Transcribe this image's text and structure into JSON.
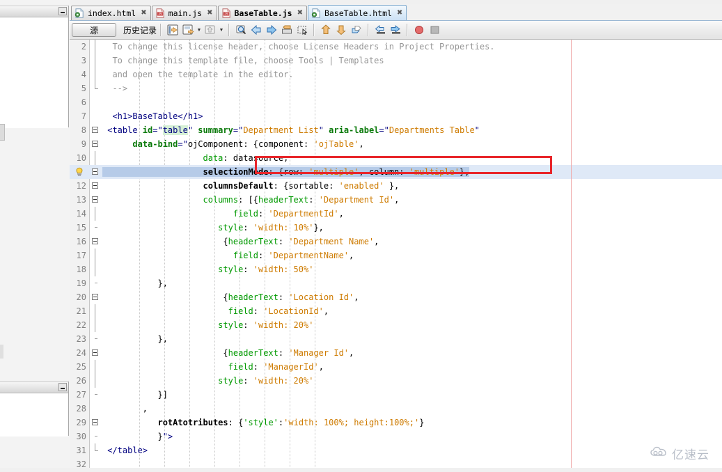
{
  "window": {
    "app": "NetBeans IDE",
    "left_panel_top": {
      "minimize_label": "minimize"
    },
    "left_panel_bottom": {
      "minimize_label": "minimize"
    }
  },
  "tabs": [
    {
      "label": "index.html",
      "icon": "html-file-icon",
      "close": "×",
      "active": false,
      "bold": false
    },
    {
      "label": "main.js",
      "icon": "js-file-icon",
      "close": "×",
      "active": false,
      "bold": false
    },
    {
      "label": "BaseTable.js",
      "icon": "js-file-icon",
      "close": "×",
      "active": false,
      "bold": true
    },
    {
      "label": "BaseTable.html",
      "icon": "html-file-icon",
      "close": "×",
      "active": true,
      "bold": false
    }
  ],
  "toolbar": {
    "source_label": "源",
    "history_label": "历史记录",
    "buttons": [
      {
        "name": "last-edit-icon"
      },
      {
        "name": "refactor-icon",
        "dropdown": true
      },
      {
        "name": "generate-code-icon",
        "dropdown": true
      },
      {
        "name": "find-selection-icon"
      },
      {
        "name": "back-icon"
      },
      {
        "name": "forward-icon"
      },
      {
        "name": "toggle-bookmark-icon"
      },
      {
        "name": "rectangular-selection-icon"
      },
      {
        "name": "previous-bookmark-icon"
      },
      {
        "name": "next-bookmark-icon"
      },
      {
        "name": "toggle-highlight-icon"
      },
      {
        "name": "shift-left-icon"
      },
      {
        "name": "shift-right-icon"
      },
      {
        "name": "start-macro-recording-icon"
      },
      {
        "name": "stop-macro-recording-icon"
      }
    ]
  },
  "editor": {
    "margin_guide_column_x": 720,
    "highlighted_line_number": 11,
    "annotation_color": "#e8262b",
    "lines": [
      {
        "n": "2",
        "indent": 0,
        "fold": "line",
        "tokens": [
          {
            "t": "comment",
            "v": "  To change this license header, choose License Headers in Project Properties."
          }
        ]
      },
      {
        "n": "3",
        "indent": 0,
        "fold": "line",
        "tokens": [
          {
            "t": "comment",
            "v": "  To change this template file, choose Tools | Templates"
          }
        ]
      },
      {
        "n": "4",
        "indent": 0,
        "fold": "line",
        "tokens": [
          {
            "t": "comment",
            "v": "  and open the template in the editor."
          }
        ]
      },
      {
        "n": "5",
        "indent": 0,
        "fold": "end",
        "tokens": [
          {
            "t": "comment",
            "v": "  -->"
          }
        ]
      },
      {
        "n": "6",
        "indent": 0,
        "fold": "none",
        "tokens": []
      },
      {
        "n": "7",
        "indent": 0,
        "fold": "none",
        "tokens": [
          {
            "t": "tag",
            "v": "  <h1>BaseTable</h1>"
          }
        ]
      },
      {
        "n": "8",
        "indent": 0,
        "fold": "box",
        "tokens": [
          {
            "t": "tag",
            "v": " <table "
          },
          {
            "t": "attr",
            "v": "id"
          },
          {
            "t": "tag",
            "v": "=\""
          },
          {
            "t": "idhl",
            "v": "table"
          },
          {
            "t": "tag",
            "v": "\" "
          },
          {
            "t": "attr",
            "v": "summary"
          },
          {
            "t": "tag",
            "v": "=\""
          },
          {
            "t": "str",
            "v": "Department List"
          },
          {
            "t": "tag",
            "v": "\" "
          },
          {
            "t": "attr",
            "v": "aria-label"
          },
          {
            "t": "tag",
            "v": "=\""
          },
          {
            "t": "str",
            "v": "Departments Table"
          },
          {
            "t": "tag",
            "v": "\""
          }
        ]
      },
      {
        "n": "9",
        "indent": 0,
        "fold": "box",
        "tokens": [
          {
            "t": "plain",
            "v": "      "
          },
          {
            "t": "attr",
            "v": "data-bind"
          },
          {
            "t": "tag",
            "v": "=\""
          },
          {
            "t": "plain",
            "v": "ojComponent"
          },
          {
            "t": "plain",
            "v": ": {component: "
          },
          {
            "t": "str",
            "v": "'ojTable'"
          },
          {
            "t": "plain",
            "v": ","
          }
        ]
      },
      {
        "n": "10",
        "indent": 0,
        "fold": "line",
        "tokens": [
          {
            "t": "plain",
            "v": "                    "
          },
          {
            "t": "green",
            "v": "data"
          },
          {
            "t": "plain",
            "v": ": datasource,"
          }
        ]
      },
      {
        "n": "11",
        "indent": 0,
        "fold": "box",
        "bulb": true,
        "highlight": true,
        "tokens": [
          {
            "t": "plain",
            "v": "                    "
          },
          {
            "t": "key",
            "v": "selectionMode"
          },
          {
            "t": "plain",
            "v": ": {row: "
          },
          {
            "t": "str",
            "v": "'multiple'"
          },
          {
            "t": "plain",
            "v": ", column: "
          },
          {
            "t": "str",
            "v": "'multiple'"
          },
          {
            "t": "plain",
            "v": "},"
          }
        ]
      },
      {
        "n": "12",
        "indent": 0,
        "fold": "box",
        "tokens": [
          {
            "t": "plain",
            "v": "                    "
          },
          {
            "t": "key",
            "v": "columnsDefault"
          },
          {
            "t": "plain",
            "v": ": {sortable: "
          },
          {
            "t": "str",
            "v": "'enabled'"
          },
          {
            "t": "plain",
            "v": " },"
          }
        ]
      },
      {
        "n": "13",
        "indent": 0,
        "fold": "box",
        "tokens": [
          {
            "t": "plain",
            "v": "                    "
          },
          {
            "t": "green",
            "v": "columns"
          },
          {
            "t": "plain",
            "v": ": [{"
          },
          {
            "t": "green",
            "v": "headerText"
          },
          {
            "t": "plain",
            "v": ": "
          },
          {
            "t": "str",
            "v": "'Department Id'"
          },
          {
            "t": "plain",
            "v": ","
          }
        ]
      },
      {
        "n": "14",
        "indent": 0,
        "fold": "line",
        "tokens": [
          {
            "t": "plain",
            "v": "                          "
          },
          {
            "t": "green",
            "v": "field"
          },
          {
            "t": "plain",
            "v": ": "
          },
          {
            "t": "str",
            "v": "'DepartmentId'"
          },
          {
            "t": "plain",
            "v": ","
          }
        ]
      },
      {
        "n": "15",
        "indent": 0,
        "fold": "tick",
        "tokens": [
          {
            "t": "plain",
            "v": "                       "
          },
          {
            "t": "green",
            "v": "style"
          },
          {
            "t": "plain",
            "v": ": "
          },
          {
            "t": "str",
            "v": "'width: 10%'"
          },
          {
            "t": "plain",
            "v": "},"
          }
        ]
      },
      {
        "n": "16",
        "indent": 0,
        "fold": "box",
        "tokens": [
          {
            "t": "plain",
            "v": "                        {"
          },
          {
            "t": "green",
            "v": "headerText"
          },
          {
            "t": "plain",
            "v": ": "
          },
          {
            "t": "str",
            "v": "'Department Name'"
          },
          {
            "t": "plain",
            "v": ","
          }
        ]
      },
      {
        "n": "17",
        "indent": 0,
        "fold": "line",
        "tokens": [
          {
            "t": "plain",
            "v": "                          "
          },
          {
            "t": "green",
            "v": "field"
          },
          {
            "t": "plain",
            "v": ": "
          },
          {
            "t": "str",
            "v": "'DepartmentName'"
          },
          {
            "t": "plain",
            "v": ","
          }
        ]
      },
      {
        "n": "18",
        "indent": 0,
        "fold": "line",
        "tokens": [
          {
            "t": "plain",
            "v": "                       "
          },
          {
            "t": "green",
            "v": "style"
          },
          {
            "t": "plain",
            "v": ": "
          },
          {
            "t": "str",
            "v": "'width: 50%'"
          }
        ]
      },
      {
        "n": "19",
        "indent": 0,
        "fold": "tick",
        "tokens": [
          {
            "t": "plain",
            "v": "           },"
          }
        ]
      },
      {
        "n": "20",
        "indent": 0,
        "fold": "box",
        "tokens": [
          {
            "t": "plain",
            "v": "                        {"
          },
          {
            "t": "green",
            "v": "headerText"
          },
          {
            "t": "plain",
            "v": ": "
          },
          {
            "t": "str",
            "v": "'Location Id'"
          },
          {
            "t": "plain",
            "v": ","
          }
        ]
      },
      {
        "n": "21",
        "indent": 0,
        "fold": "line",
        "tokens": [
          {
            "t": "plain",
            "v": "                         "
          },
          {
            "t": "green",
            "v": "field"
          },
          {
            "t": "plain",
            "v": ": "
          },
          {
            "t": "str",
            "v": "'LocationId'"
          },
          {
            "t": "plain",
            "v": ","
          }
        ]
      },
      {
        "n": "22",
        "indent": 0,
        "fold": "line",
        "tokens": [
          {
            "t": "plain",
            "v": "                       "
          },
          {
            "t": "green",
            "v": "style"
          },
          {
            "t": "plain",
            "v": ": "
          },
          {
            "t": "str",
            "v": "'width: 20%'"
          }
        ]
      },
      {
        "n": "23",
        "indent": 0,
        "fold": "tick",
        "tokens": [
          {
            "t": "plain",
            "v": "           },"
          }
        ]
      },
      {
        "n": "24",
        "indent": 0,
        "fold": "box",
        "tokens": [
          {
            "t": "plain",
            "v": "                        {"
          },
          {
            "t": "green",
            "v": "headerText"
          },
          {
            "t": "plain",
            "v": ": "
          },
          {
            "t": "str",
            "v": "'Manager Id'"
          },
          {
            "t": "plain",
            "v": ","
          }
        ]
      },
      {
        "n": "25",
        "indent": 0,
        "fold": "line",
        "tokens": [
          {
            "t": "plain",
            "v": "                         "
          },
          {
            "t": "green",
            "v": "field"
          },
          {
            "t": "plain",
            "v": ": "
          },
          {
            "t": "str",
            "v": "'ManagerId'"
          },
          {
            "t": "plain",
            "v": ","
          }
        ]
      },
      {
        "n": "26",
        "indent": 0,
        "fold": "line",
        "tokens": [
          {
            "t": "plain",
            "v": "                       "
          },
          {
            "t": "green",
            "v": "style"
          },
          {
            "t": "plain",
            "v": ": "
          },
          {
            "t": "str",
            "v": "'width: 20%'"
          }
        ]
      },
      {
        "n": "27",
        "indent": 0,
        "fold": "tick",
        "tokens": [
          {
            "t": "plain",
            "v": "           }]"
          }
        ]
      },
      {
        "n": "28",
        "indent": 0,
        "fold": "none",
        "tokens": [
          {
            "t": "plain",
            "v": "        ,"
          }
        ]
      },
      {
        "n": "29",
        "indent": 0,
        "fold": "box",
        "tokens": [
          {
            "t": "plain",
            "v": "           "
          },
          {
            "t": "key",
            "v": "rotAtotributes"
          },
          {
            "t": "plain",
            "v": ": {"
          },
          {
            "t": "green",
            "v": "'style'"
          },
          {
            "t": "plain",
            "v": ":"
          },
          {
            "t": "str",
            "v": "'width: 100%; height:100%;'"
          },
          {
            "t": "plain",
            "v": "}"
          }
        ]
      },
      {
        "n": "30",
        "indent": 0,
        "fold": "tick",
        "tokens": [
          {
            "t": "plain",
            "v": "           }"
          },
          {
            "t": "tag",
            "v": "\">"
          }
        ]
      },
      {
        "n": "31",
        "indent": 0,
        "fold": "end",
        "tokens": [
          {
            "t": "tag",
            "v": " </table>"
          }
        ]
      },
      {
        "n": "32",
        "indent": 0,
        "fold": "none",
        "tokens": []
      }
    ]
  },
  "watermark": {
    "text": "亿速云",
    "icon": "cloud-icon"
  }
}
